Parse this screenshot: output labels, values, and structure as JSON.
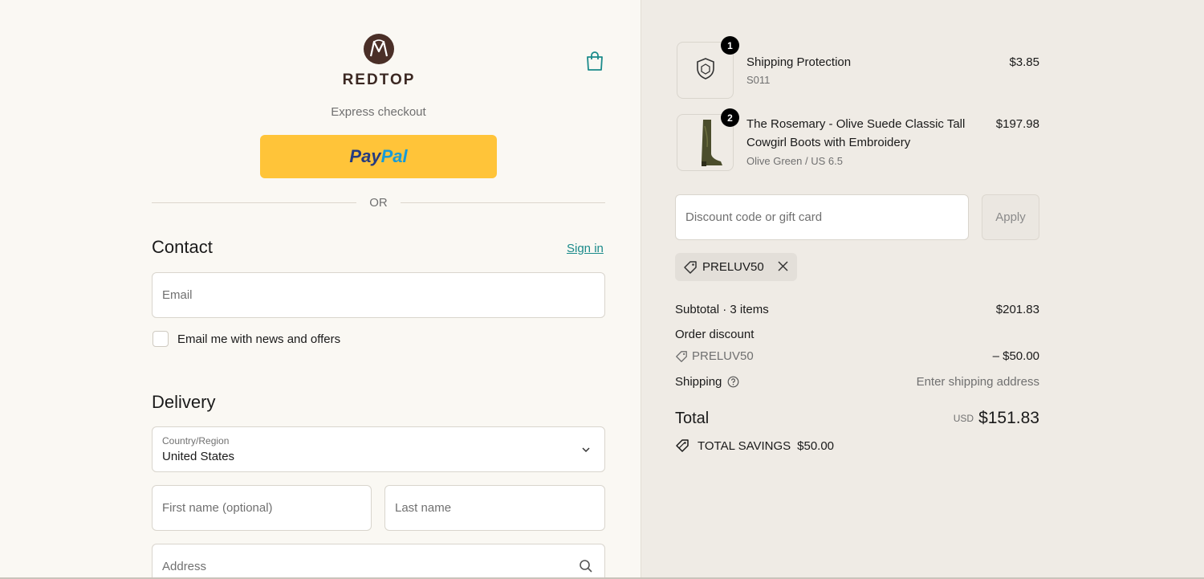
{
  "brand": {
    "name": "REDTOP"
  },
  "express": {
    "title": "Express checkout",
    "paypal_label_1": "Pay",
    "paypal_label_2": "Pal",
    "or": "OR"
  },
  "contact": {
    "heading": "Contact",
    "sign_in": "Sign in",
    "email_placeholder": "Email",
    "news_label": "Email me with news and offers"
  },
  "delivery": {
    "heading": "Delivery",
    "country_label": "Country/Region",
    "country_value": "United States",
    "first_name_placeholder": "First name (optional)",
    "last_name_placeholder": "Last name",
    "address_placeholder": "Address"
  },
  "cart": {
    "items": [
      {
        "qty": "1",
        "title": "Shipping Protection",
        "subtitle": "S011",
        "price": "$3.85",
        "thumb_text": "Shipping Protection"
      },
      {
        "qty": "2",
        "title_line1": "The Rosemary - Olive Suede Classic Tall",
        "title_line2": "Cowgirl Boots with Embroidery",
        "subtitle": "Olive Green / US 6.5",
        "price": "$197.98"
      }
    ],
    "discount_placeholder": "Discount code or gift card",
    "apply_label": "Apply",
    "applied_code": "PRELUV50"
  },
  "summary": {
    "subtotal_label": "Subtotal · 3 items",
    "subtotal_value": "$201.83",
    "order_discount_label": "Order discount",
    "discount_code": "PRELUV50",
    "discount_value": "– $50.00",
    "shipping_label": "Shipping",
    "shipping_value": "Enter shipping address",
    "total_label": "Total",
    "total_currency": "USD",
    "total_value": "$151.83",
    "savings_label": "TOTAL SAVINGS",
    "savings_value": "$50.00"
  },
  "colors": {
    "accent": "#1a8a8a",
    "paypal": "#ffc439",
    "brand": "#4a2f27"
  }
}
